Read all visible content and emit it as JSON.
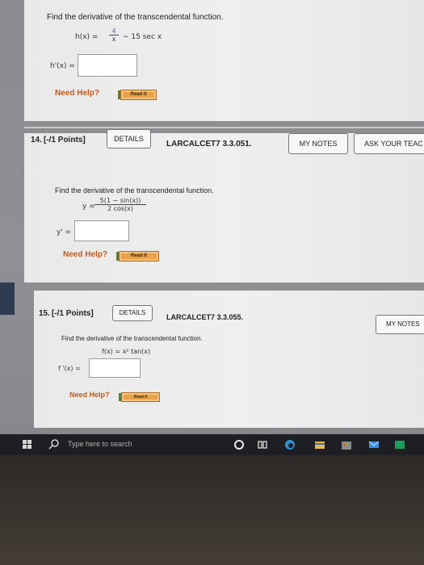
{
  "q13": {
    "prompt": "Find the derivative of the transcendental function.",
    "func_lhs": "h(x) =",
    "frac_num": "4",
    "frac_den": "x",
    "func_rest": "− 15 sec x",
    "answer_label": "h'(x) =",
    "answer_value": "",
    "need_help": "Need Help?",
    "read_it": "Read It"
  },
  "q14": {
    "number": "14.",
    "points": "[-/1 Points]",
    "details": "DETAILS",
    "code": "LARCALCET7 3.3.051.",
    "my_notes": "MY NOTES",
    "ask_teacher": "ASK YOUR TEAC",
    "prompt": "Find the derivative of the transcendental function.",
    "func_lhs": "y =",
    "frac_num": "5(1 − sin(x))",
    "frac_den": "2 cos(x)",
    "answer_label": "y' =",
    "answer_value": "",
    "need_help": "Need Help?",
    "read_it": "Read It"
  },
  "q15": {
    "number": "15.",
    "points": "[-/1 Points]",
    "details": "DETAILS",
    "code": "LARCALCET7 3.3.055.",
    "my_notes": "MY NOTES",
    "prompt": "Find the derivative of the transcendental function.",
    "func": "f(x) = x² tan(x)",
    "answer_label": "f '(x) =",
    "answer_value": "",
    "need_help": "Need Help?",
    "read_it": "Read It"
  },
  "taskbar": {
    "search_placeholder": "Type here to search",
    "icons": [
      "windows-start-icon",
      "search-icon",
      "cortana-circle-icon",
      "task-view-icon",
      "edge-icon",
      "file-explorer-icon",
      "store-icon",
      "mail-icon",
      "photos-icon"
    ]
  },
  "colors": {
    "accent_orange": "#c05a1a",
    "read_button": "#e9a14a",
    "taskbar": "#1d1f23"
  }
}
